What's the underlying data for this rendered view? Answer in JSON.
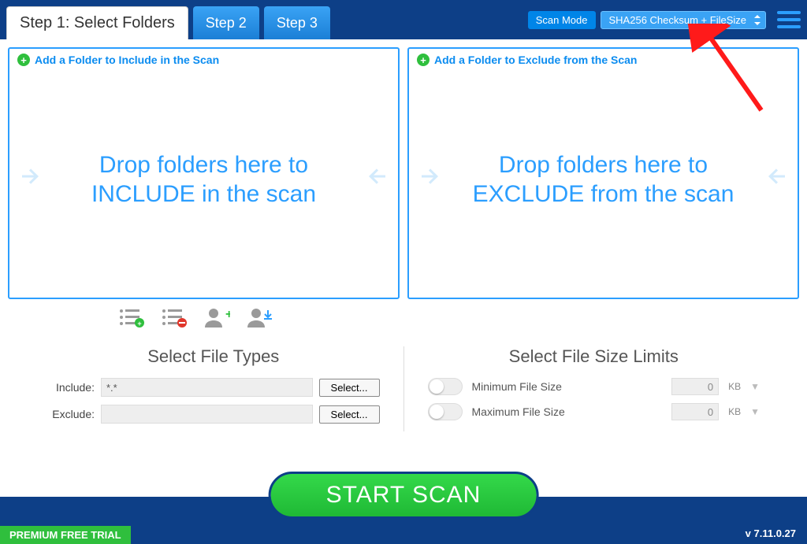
{
  "tabs": {
    "step1": "Step 1: Select Folders",
    "step2": "Step 2",
    "step3": "Step 3"
  },
  "scanmode": {
    "label": "Scan Mode",
    "value": "SHA256 Checksum + FileSize"
  },
  "panels": {
    "include": {
      "header": "Add a Folder to Include in the Scan",
      "drop": "Drop folders here to INCLUDE in the scan"
    },
    "exclude": {
      "header": "Add a Folder to Exclude from the Scan",
      "drop": "Drop folders here to EXCLUDE from the scan"
    }
  },
  "filetypes": {
    "title": "Select File Types",
    "include_label": "Include:",
    "include_value": "*.*",
    "exclude_label": "Exclude:",
    "exclude_value": "",
    "select_btn": "Select..."
  },
  "filesize": {
    "title": "Select File Size Limits",
    "min_label": "Minimum File Size",
    "max_label": "Maximum File Size",
    "min_value": "0",
    "max_value": "0",
    "unit": "KB"
  },
  "start": "START SCAN",
  "footer": {
    "trial": "PREMIUM FREE TRIAL",
    "version": "v 7.11.0.27"
  }
}
